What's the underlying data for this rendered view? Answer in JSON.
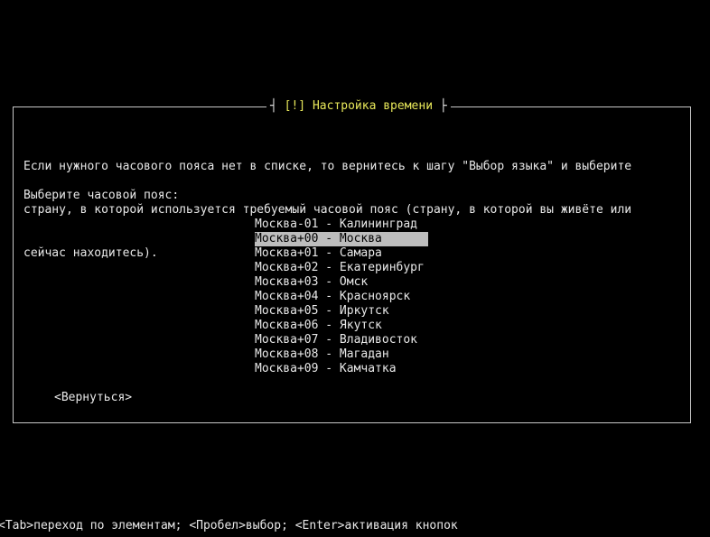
{
  "dialog": {
    "title_left": "┤ ",
    "title": "[!] Настройка времени",
    "title_right": " ├",
    "instruction_lines": [
      "Если нужного часового пояса нет в списке, то вернитесь к шагу \"Выбор языка\" и выберите",
      "страну, в которой используется требуемый часовой пояс (страну, в которой вы живёте или",
      "сейчас находитесь)."
    ],
    "prompt": "Выберите часовой пояс:",
    "timezones": [
      "Москва-01 - Калининград",
      "Москва+00 - Москва",
      "Москва+01 - Самара",
      "Москва+02 - Екатеринбург",
      "Москва+03 - Омск",
      "Москва+04 - Красноярск",
      "Москва+05 - Иркутск",
      "Москва+06 - Якутск",
      "Москва+07 - Владивосток",
      "Москва+08 - Магадан",
      "Москва+09 - Камчатка"
    ],
    "selected_timezone": "Москва+00 - Москва",
    "back_button": "<Вернуться>"
  },
  "help_line": "<Tab>переход по элементам; <Пробел>выбор; <Enter>активация кнопок",
  "colors": {
    "background": "#000000",
    "text": "#e8e8e8",
    "title": "#e8e85a",
    "highlight_bg": "#bdbdbd",
    "highlight_fg": "#000000"
  }
}
